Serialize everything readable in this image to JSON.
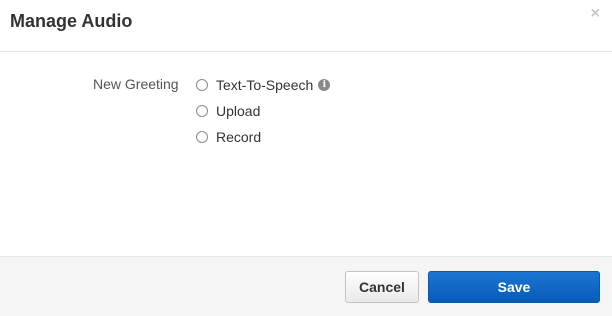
{
  "dialog": {
    "title": "Manage Audio",
    "close_symbol": "×"
  },
  "form": {
    "field_label": "New Greeting",
    "options": [
      {
        "label": "Text-To-Speech",
        "selected": false,
        "has_info_icon": true,
        "info_icon": "info-icon",
        "info_symbol": "i"
      },
      {
        "label": "Upload",
        "selected": false
      },
      {
        "label": "Record",
        "selected": false
      }
    ]
  },
  "footer": {
    "cancel_label": "Cancel",
    "save_label": "Save"
  },
  "colors": {
    "primary": "#0a5bb8",
    "footer_bg": "#f5f5f5"
  }
}
